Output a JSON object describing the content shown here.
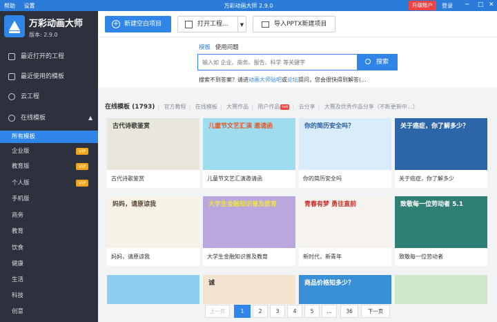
{
  "window": {
    "menu": [
      "帮助",
      "设置"
    ],
    "title": "万彩动画大师 2.9.0",
    "upgrade_label": "升级账户",
    "login_label": "登录",
    "controls": [
      "─",
      "□",
      "✕"
    ]
  },
  "app": {
    "name": "万彩动画大师",
    "version": "版本: 2.9.0"
  },
  "sidebar": {
    "items": [
      {
        "label": "最近打开的工程"
      },
      {
        "label": "最近使用的模板"
      },
      {
        "label": "云工程"
      },
      {
        "label": "在线模板",
        "expanded": true
      }
    ],
    "caret": "▲",
    "sub_items": [
      {
        "label": "所有模板",
        "active": true
      },
      {
        "label": "企业版",
        "badge": "VIP"
      },
      {
        "label": "教育版",
        "badge": "VIP"
      },
      {
        "label": "个人版",
        "badge": "VIP"
      },
      {
        "label": "手机版"
      },
      {
        "label": "商务"
      },
      {
        "label": "教育"
      },
      {
        "label": "饮食"
      },
      {
        "label": "健康"
      },
      {
        "label": "生活"
      },
      {
        "label": "科技"
      },
      {
        "label": "创意"
      }
    ]
  },
  "toolbar": {
    "new_project": "新建空白项目",
    "open_project": "打开工程...",
    "dropdown": "▼",
    "import_pptx": "导入PPTX新建项目"
  },
  "search": {
    "tab_active": "模板",
    "tab_other": "使用问题",
    "placeholder": "输入如 企业、商务、报告、科学 等关键字",
    "button": "搜索",
    "help_prefix": "搜索不到答案？请进",
    "help_link1": "动画大师贴吧",
    "help_or": "或",
    "help_link2": "论坛",
    "help_suffix": "提问，您会很快得到解答(..."
  },
  "filter": {
    "title": "在线模板 (1793)",
    "links": [
      "官方教程",
      "在线模板",
      "大赛作品",
      "用户作品",
      "云分享",
      "大赛及优秀作品分享（不断更新中…）"
    ],
    "hot_badge": "hot"
  },
  "templates": [
    {
      "caption": "古代诗歌鉴赏",
      "img_text": "古代诗歌鉴赏",
      "bg": "#e9e6dc",
      "fg": "#3a3a3a"
    },
    {
      "caption": "儿童节文艺汇演邀请函",
      "img_text": "儿童节文艺汇演 邀请函",
      "bg": "#9fdcf0",
      "fg": "#e65a2a"
    },
    {
      "caption": "你的简历安全吗",
      "img_text": "你的简历安全吗？",
      "bg": "#d9ecfb",
      "fg": "#2b5e9b"
    },
    {
      "caption": "关于癌症，你了解多少",
      "img_text": "关于癌症，你了解多少？",
      "bg": "#2d66a8",
      "fg": "#ffffff"
    },
    {
      "caption": "妈妈，请原谅我",
      "img_text": "妈妈，请原谅我",
      "bg": "#f7f2e6",
      "fg": "#5a4a3a"
    },
    {
      "caption": "大学生金融知识普及教育",
      "img_text": "大学生金融知识普及教育",
      "bg": "#b9a7de",
      "fg": "#f0e24a"
    },
    {
      "caption": "新时代，新青年",
      "img_text": "青春有梦 勇往直前",
      "bg": "#f6f3ee",
      "fg": "#c8302a"
    },
    {
      "caption": "致敬每一位劳动者",
      "img_text": "致敬每一位劳动者 5.1",
      "bg": "#2f7f74",
      "fg": "#ffffff"
    },
    {
      "caption": "",
      "img_text": "",
      "bg": "#8fcdf0",
      "fg": "#333"
    },
    {
      "caption": "",
      "img_text": "诚",
      "bg": "#f3e4cf",
      "fg": "#333"
    },
    {
      "caption": "",
      "img_text": "商品价格知多少？",
      "bg": "#3a8fd9",
      "fg": "#ffffff"
    },
    {
      "caption": "",
      "img_text": "",
      "bg": "#cfe6c8",
      "fg": "#333"
    }
  ],
  "pagination": {
    "prev": "上一页",
    "pages": [
      "1",
      "2",
      "3",
      "4",
      "5",
      "...",
      "36"
    ],
    "current": "1",
    "next": "下一页"
  },
  "colors": {
    "accent": "#2f86e8",
    "sidebar_bg": "#2c313d",
    "vip": "#f0a51c",
    "upgrade": "#e44444"
  }
}
